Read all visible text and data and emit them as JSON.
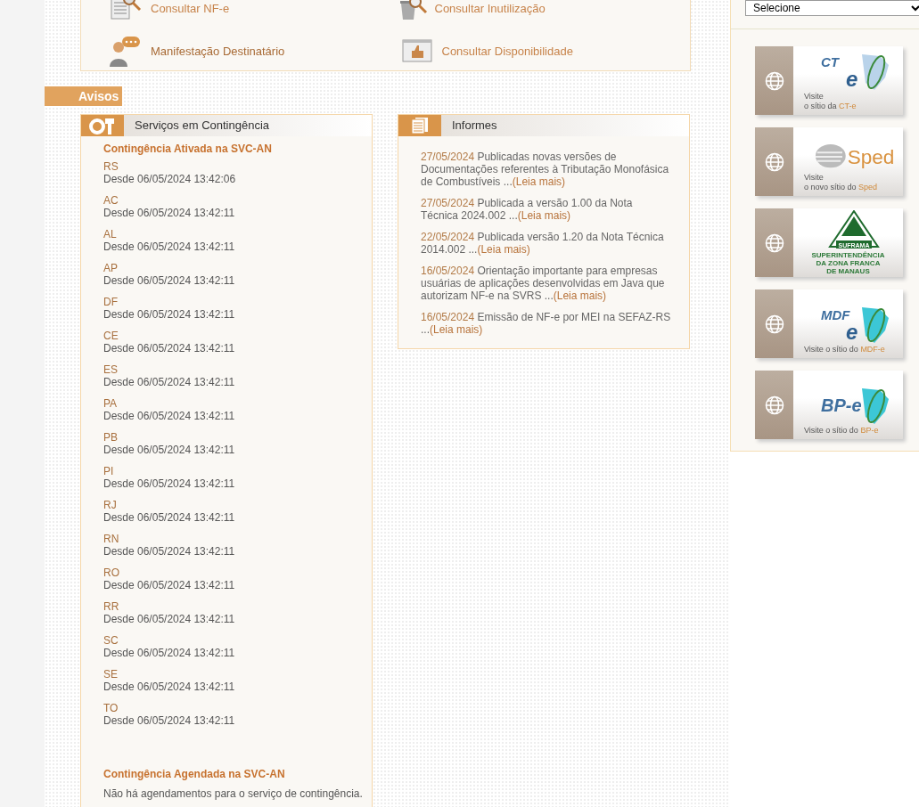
{
  "quick_links": [
    {
      "kind": "doc-search",
      "label": "Consultar NF-e"
    },
    {
      "kind": "trash-search",
      "label": "Consultar Inutilização"
    },
    {
      "kind": "person-chat",
      "label": "Manifestação Destinatário"
    },
    {
      "kind": "thumbs-window",
      "label": "Consultar Disponibilidade"
    }
  ],
  "section_title": "Avisos",
  "contingency": {
    "title": "Serviços em Contingência",
    "active_heading": "Contingência Ativada na SVC-AN",
    "states": [
      {
        "uf": "RS",
        "since": "Desde 06/05/2024 13:42:06"
      },
      {
        "uf": "AC",
        "since": "Desde 06/05/2024 13:42:11"
      },
      {
        "uf": "AL",
        "since": "Desde 06/05/2024 13:42:11"
      },
      {
        "uf": "AP",
        "since": "Desde 06/05/2024 13:42:11"
      },
      {
        "uf": "DF",
        "since": "Desde 06/05/2024 13:42:11"
      },
      {
        "uf": "CE",
        "since": "Desde 06/05/2024 13:42:11"
      },
      {
        "uf": "ES",
        "since": "Desde 06/05/2024 13:42:11"
      },
      {
        "uf": "PA",
        "since": "Desde 06/05/2024 13:42:11"
      },
      {
        "uf": "PB",
        "since": "Desde 06/05/2024 13:42:11"
      },
      {
        "uf": "PI",
        "since": "Desde 06/05/2024 13:42:11"
      },
      {
        "uf": "RJ",
        "since": "Desde 06/05/2024 13:42:11"
      },
      {
        "uf": "RN",
        "since": "Desde 06/05/2024 13:42:11"
      },
      {
        "uf": "RO",
        "since": "Desde 06/05/2024 13:42:11"
      },
      {
        "uf": "RR",
        "since": "Desde 06/05/2024 13:42:11"
      },
      {
        "uf": "SC",
        "since": "Desde 06/05/2024 13:42:11"
      },
      {
        "uf": "SE",
        "since": "Desde 06/05/2024 13:42:11"
      },
      {
        "uf": "TO",
        "since": "Desde 06/05/2024 13:42:11"
      }
    ],
    "scheduled_heading": "Contingência Agendada na SVC-AN",
    "scheduled_text": "Não há agendamentos para o serviço de contingência."
  },
  "informes": {
    "title": "Informes",
    "items": [
      {
        "date": "27/05/2024",
        "text": "Publicadas novas versões de Documentações referentes à Tributação Monofásica de Combustíveis ...",
        "link": "(Leia mais)"
      },
      {
        "date": "27/05/2024",
        "text": "Publicada a versão 1.00 da Nota Técnica 2024.002 ...",
        "link": "(Leia mais)"
      },
      {
        "date": "22/05/2024",
        "text": "Publicada versão 1.20 da Nota Técnica 2014.002 ...",
        "link": "(Leia mais)"
      },
      {
        "date": "16/05/2024",
        "text": "Orientação importante para empresas usuárias de aplicações desenvolvidas em Java que autorizam NF-e na SVRS ...",
        "link": "(Leia mais)"
      },
      {
        "date": "16/05/2024",
        "text": "Emissão de NF-e por MEI na SEFAZ-RS ...",
        "link": "(Leia mais)"
      }
    ]
  },
  "sidebar": {
    "select": {
      "value": "Selecione"
    },
    "banners": [
      {
        "kind": "cte",
        "logo": "CT",
        "logo_sub": "e",
        "caption": [
          {
            "text": "Visite"
          },
          {
            "text": "o sítio da ",
            "highlight": "CT-e"
          }
        ]
      },
      {
        "kind": "sped",
        "logo": "Sped",
        "caption": [
          {
            "text": "Visite"
          },
          {
            "text": "o novo sítio do ",
            "highlight": "Sped"
          }
        ]
      },
      {
        "kind": "suframa",
        "logo": "SUFRAMA",
        "caption": [
          {
            "text": "SUPERINTENDÊNCIA"
          },
          {
            "text": "DA ZONA FRANCA"
          },
          {
            "text": "DE MANAUS"
          }
        ]
      },
      {
        "kind": "mdfe",
        "logo": "MDF",
        "logo_sub": "e",
        "caption": [
          {
            "text": "Visite o sítio do ",
            "highlight": "MDF-e"
          }
        ]
      },
      {
        "kind": "bpe",
        "logo": "BP-e",
        "caption": [
          {
            "text": "Visite o sítio do ",
            "highlight": "BP-e"
          }
        ]
      }
    ]
  }
}
